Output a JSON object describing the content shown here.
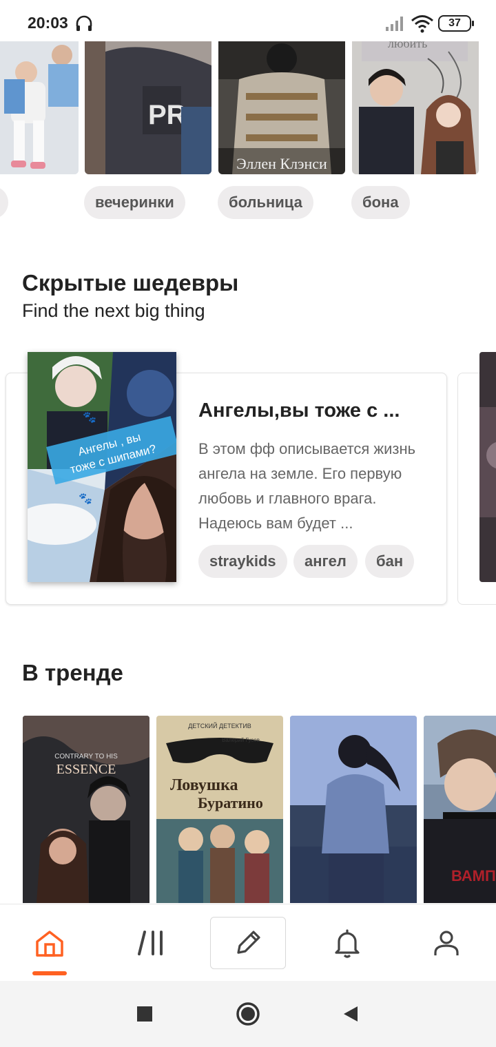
{
  "status_bar": {
    "time": "20:03",
    "battery": "37"
  },
  "top_tags": [
    "вечеринки",
    "больница",
    "бона"
  ],
  "top_covers": [
    {
      "name": "cover-group-boys",
      "colors": [
        "#d9dde3",
        "#6fa6d8"
      ]
    },
    {
      "name": "cover-hoodie",
      "colors": [
        "#8a8686",
        "#3a3a44"
      ]
    },
    {
      "name": "cover-ellen-clancy",
      "colors": [
        "#6e6a62",
        "#1d1c1b"
      ],
      "caption": "Эллен Клэнси"
    },
    {
      "name": "cover-couple",
      "colors": [
        "#c8c4c0",
        "#3a3840"
      ],
      "caption": "любить"
    }
  ],
  "hidden_gems": {
    "title": "Скрытые шедевры",
    "subtitle": "Find the next big thing",
    "story": {
      "title": "Ангелы,вы  тоже с ...",
      "description": "В этом фф описывается жизнь ангела  на земле. Его первую любовь и главного врага. Надеюсь вам будет ...",
      "cover_text": "Ангелы , вы тоже с шипами?",
      "tags": [
        "straykids",
        "ангел",
        "бан"
      ]
    }
  },
  "trending": {
    "title": "В тренде",
    "covers": [
      {
        "name": "cover-contrary",
        "text_top": "CONTRARY TO HIS",
        "text_main": "ESSENCE"
      },
      {
        "name": "cover-buratino",
        "text_top": "ДЕТСКИЙ ДЕТЕКТИВ",
        "text_main": "Ловушка для Буратино",
        "author": "Валерий Гусев"
      },
      {
        "name": "cover-sea-girl"
      },
      {
        "name": "cover-boy-vampire",
        "text_main": "ВАМП"
      }
    ]
  },
  "bottom_nav": {
    "items": [
      "home",
      "library",
      "write",
      "notifications",
      "profile"
    ],
    "accent": "#ff6122"
  }
}
